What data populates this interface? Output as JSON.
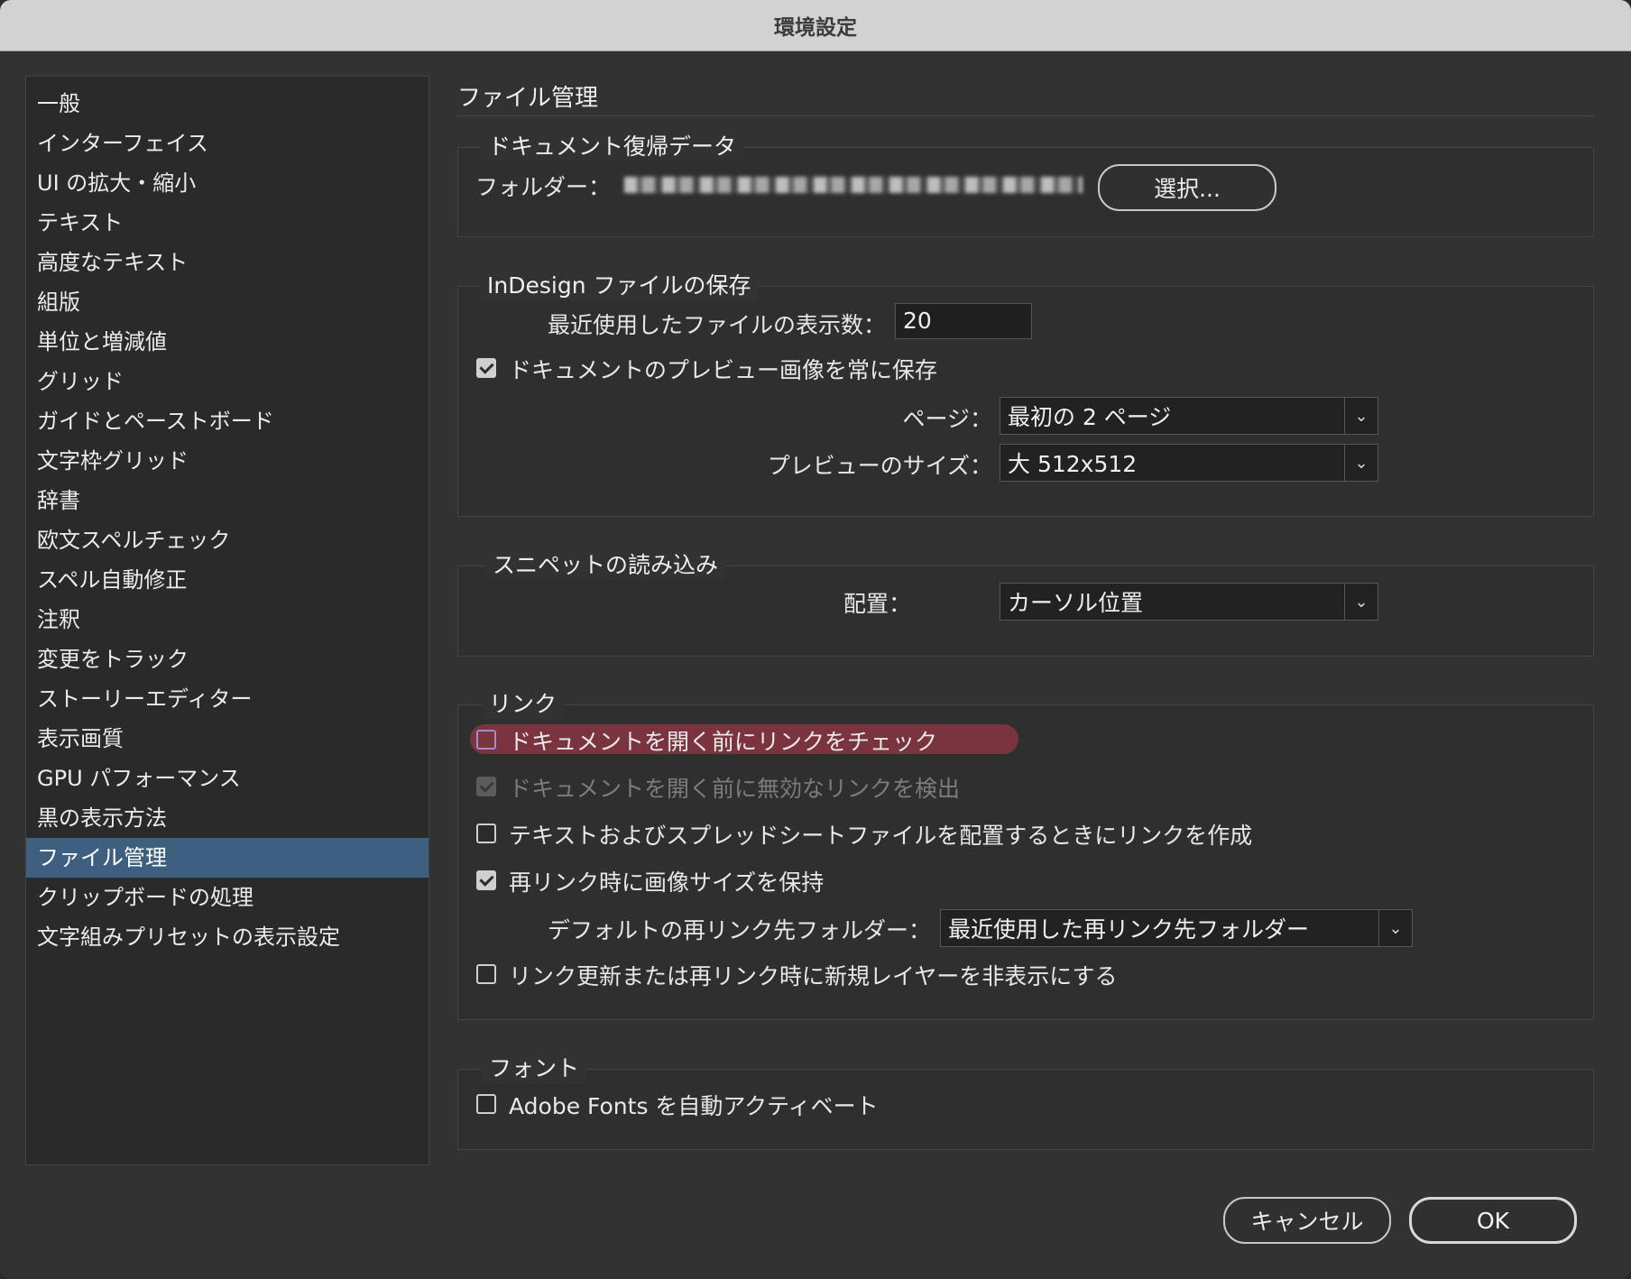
{
  "window": {
    "title": "環境設定"
  },
  "sidebar": {
    "items": [
      "一般",
      "インターフェイス",
      "UI の拡大・縮小",
      "テキスト",
      "高度なテキスト",
      "組版",
      "単位と増減値",
      "グリッド",
      "ガイドとペーストボード",
      "文字枠グリッド",
      "辞書",
      "欧文スペルチェック",
      "スペル自動修正",
      "注釈",
      "変更をトラック",
      "ストーリーエディター",
      "表示画質",
      "GPU パフォーマンス",
      "黒の表示方法",
      "ファイル管理",
      "クリップボードの処理",
      "文字組みプリセットの表示設定"
    ],
    "selected_index": 19
  },
  "main": {
    "title": "ファイル管理",
    "recovery": {
      "group_label": "ドキュメント復帰データ",
      "folder_label": "フォルダー：",
      "choose_button": "選択..."
    },
    "save": {
      "group_label": "InDesign ファイルの保存",
      "recent_label": "最近使用したファイルの表示数：",
      "recent_value": "20",
      "preview_check_label": "ドキュメントのプレビュー画像を常に保存",
      "preview_checked": true,
      "pages_label": "ページ：",
      "pages_value": "最初の 2 ページ",
      "size_label": "プレビューのサイズ：",
      "size_value": "大 512x512"
    },
    "snippet": {
      "group_label": "スニペットの読み込み",
      "place_label": "配置：",
      "place_value": "カーソル位置"
    },
    "links": {
      "group_label": "リンク",
      "check_before_open": "ドキュメントを開く前にリンクをチェック",
      "find_missing": "ドキュメントを開く前に無効なリンクを検出",
      "create_links": "テキストおよびスプレッドシートファイルを配置するときにリンクを作成",
      "preserve_size": "再リンク時に画像サイズを保持",
      "default_folder_label": "デフォルトの再リンク先フォルダー：",
      "default_folder_value": "最近使用した再リンク先フォルダー",
      "hide_layers": "リンク更新または再リンク時に新規レイヤーを非表示にする"
    },
    "fonts": {
      "group_label": "フォント",
      "auto_activate": "Adobe Fonts を自動アクティベート"
    }
  },
  "footer": {
    "cancel": "キャンセル",
    "ok": "OK"
  }
}
